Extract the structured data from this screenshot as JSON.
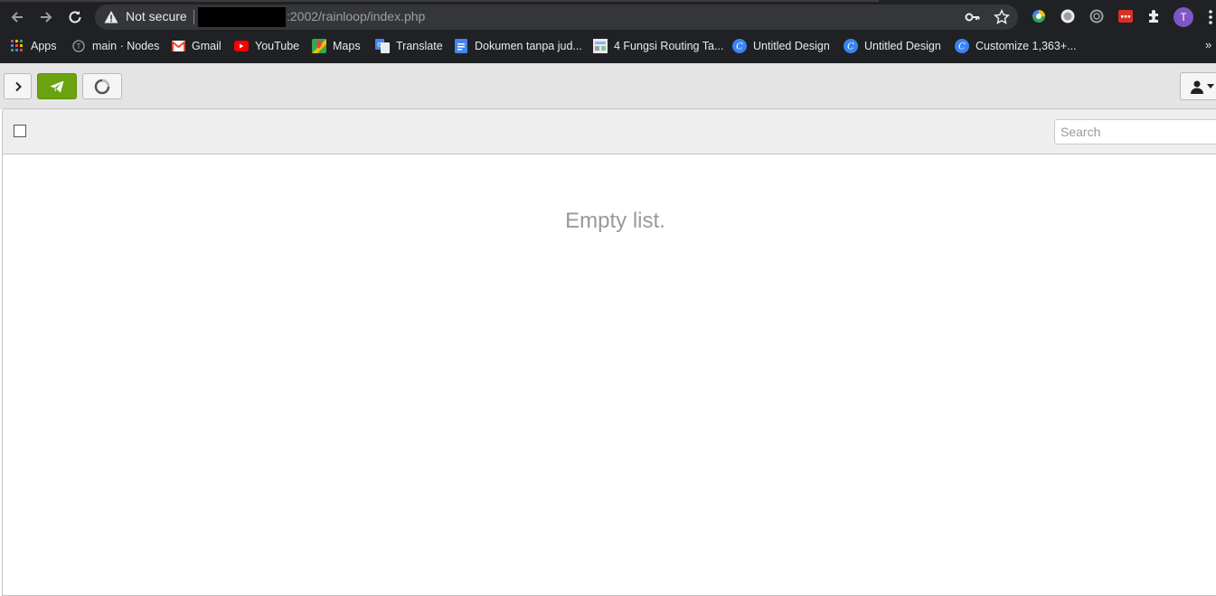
{
  "browser": {
    "security_label": "Not secure",
    "url": ":2002/rainloop/index.php",
    "avatar_letter": "T",
    "bookmarks": [
      {
        "label": "Apps",
        "icon": "apps-grid-icon"
      },
      {
        "label": "main · Nodes",
        "icon": "nodes-icon"
      },
      {
        "label": "Gmail",
        "icon": "gmail-icon"
      },
      {
        "label": "YouTube",
        "icon": "youtube-icon"
      },
      {
        "label": "Maps",
        "icon": "maps-icon"
      },
      {
        "label": "Translate",
        "icon": "translate-icon"
      },
      {
        "label": "Dokumen tanpa jud...",
        "icon": "docs-icon"
      },
      {
        "label": "4 Fungsi Routing Ta...",
        "icon": "page-favicon-icon"
      },
      {
        "label": "Untitled Design",
        "icon": "canva-icon"
      },
      {
        "label": "Untitled Design",
        "icon": "canva-icon"
      },
      {
        "label": "Customize 1,363+...",
        "icon": "canva-icon"
      }
    ],
    "more_label": "»"
  },
  "mail": {
    "search_placeholder": "Search",
    "empty_message": "Empty list."
  },
  "colors": {
    "chrome_bg": "#202124",
    "compose_green": "#6aa30f",
    "toolbar_bg": "#e4e4e4"
  }
}
